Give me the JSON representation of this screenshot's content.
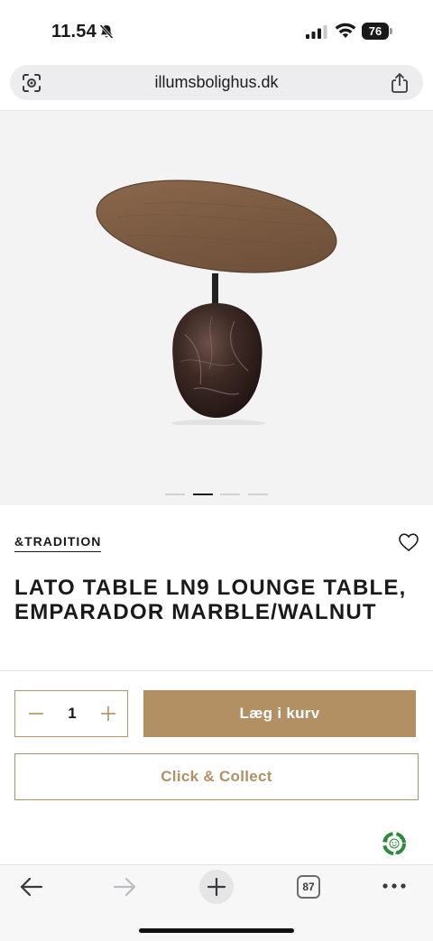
{
  "status_bar": {
    "time": "11.54",
    "battery_level": "76"
  },
  "browser": {
    "url": "illumsbolighus.dk",
    "tab_count": "87"
  },
  "product": {
    "brand": "&TRADITION",
    "title": "LATO TABLE LN9 LOUNGE TABLE, EMPARADOR MARBLE/WALNUT",
    "quantity": "1",
    "add_to_cart_label": "Læg i kurv",
    "click_collect_label": "Click & Collect",
    "gallery": {
      "count": 4,
      "active_index": 1
    }
  },
  "colors": {
    "accent": "#b39064",
    "text": "#1a1a1a",
    "image_background": "#f3f3f3"
  },
  "icons": {
    "status": [
      "bell-slash-icon",
      "signal-icon",
      "wifi-icon",
      "battery-icon"
    ],
    "address_bar": [
      "lens-icon",
      "share-icon"
    ],
    "product": [
      "heart-icon",
      "recycle-icon"
    ],
    "toolbar": [
      "back-arrow-icon",
      "forward-arrow-icon",
      "plus-icon",
      "tabs-icon",
      "more-icon"
    ]
  }
}
